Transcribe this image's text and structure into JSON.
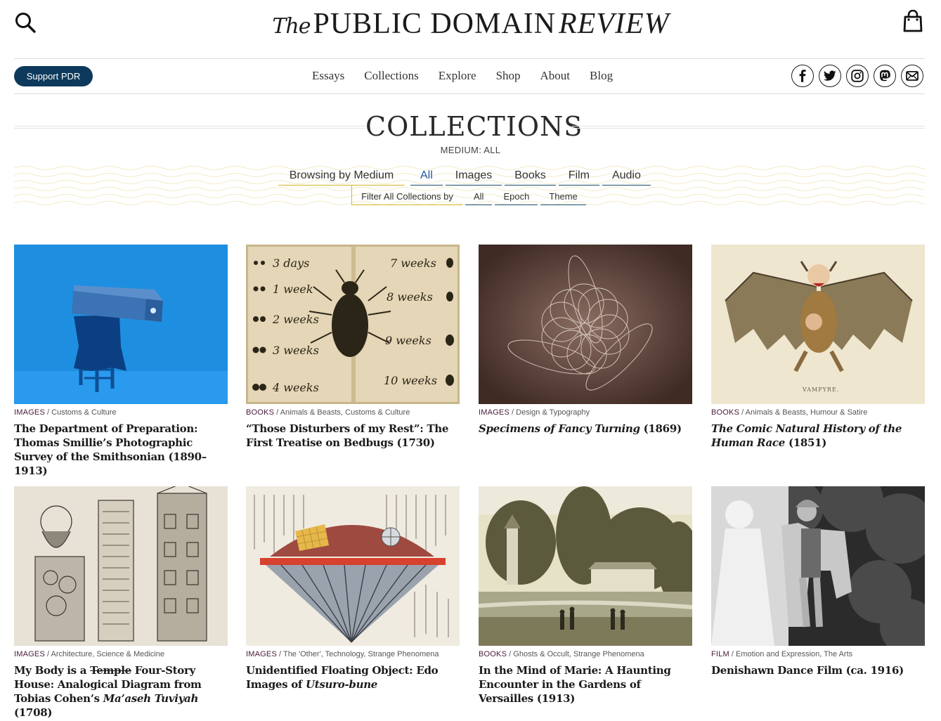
{
  "header": {
    "logo": {
      "the": "The",
      "main": "PUBLIC DOMAIN",
      "review": "REVIEW"
    },
    "search_icon": "search-icon",
    "bag_icon": "shopping-bag-icon"
  },
  "nav": {
    "support_label": "Support PDR",
    "items": [
      "Essays",
      "Collections",
      "Explore",
      "Shop",
      "About",
      "Blog"
    ],
    "social": [
      "facebook-icon",
      "twitter-icon",
      "instagram-icon",
      "mastodon-icon",
      "mail-icon"
    ]
  },
  "page": {
    "title": "COLLECTIONS",
    "subtitle": "MEDIUM: ALL"
  },
  "browse": {
    "label": "Browsing by Medium",
    "tabs": [
      "All",
      "Images",
      "Books",
      "Film",
      "Audio"
    ],
    "active_tab": "All",
    "filter_label": "Filter All Collections by",
    "filters": [
      "All",
      "Epoch",
      "Theme"
    ]
  },
  "cards": [
    {
      "medium": "IMAGES",
      "tags": " / Customs & Culture",
      "title": "The Department of Preparation: Thomas Smillie’s Photographic Survey of the Smithsonian (1890–1913)"
    },
    {
      "medium": "BOOKS",
      "tags": " / Animals & Beasts, Customs & Culture",
      "title": "“Those Disturbers of my Rest”: The First Treatise on Bedbugs (1730)"
    },
    {
      "medium": "IMAGES",
      "tags": " / Design & Typography",
      "title_italic": "Specimens of Fancy Turning",
      "title_rest": " (1869)"
    },
    {
      "medium": "BOOKS",
      "tags": " / Animals & Beasts, Humour & Satire",
      "title_italic": "The Comic Natural History of the Human Race",
      "title_rest": " (1851)"
    },
    {
      "medium": "IMAGES",
      "tags": " / Architecture, Science & Medicine",
      "title_a": "My Body is a ",
      "title_strike": "Temple",
      "title_b": " Four-Story House: Analogical Diagram from Tobias Cohen’s ",
      "title_italic": "Ma’aseh Tuviyah",
      "title_rest": " (1708)"
    },
    {
      "medium": "IMAGES",
      "tags": " / The 'Other', Technology, Strange Phenomena",
      "title_a": "Unidentified Floating Object: Edo Images of ",
      "title_italic": "Utsuro-bune"
    },
    {
      "medium": "BOOKS",
      "tags": " / Ghosts & Occult, Strange Phenomena",
      "title": "In the Mind of Marie: A Haunting Encounter in the Gardens of Versailles (1913)"
    },
    {
      "medium": "FILM",
      "tags": " / Emotion and Expression, The Arts",
      "title": "Denishawn Dance Film (ca. 1916)"
    }
  ],
  "image_text": {
    "bedbug_left": [
      "3 days",
      "1 week",
      "2 weeks",
      "3 weeks",
      "4 weeks"
    ],
    "bedbug_right": [
      "7 weeks",
      "8 weeks",
      "9 weeks",
      "10 weeks"
    ],
    "vampyre": "VAMPYRE."
  },
  "colors": {
    "support_bg": "#0d3a5c",
    "tab_underline": "#1d4d6d",
    "gold_line": "#d4b72a",
    "medium_label": "#4a1a3a"
  }
}
